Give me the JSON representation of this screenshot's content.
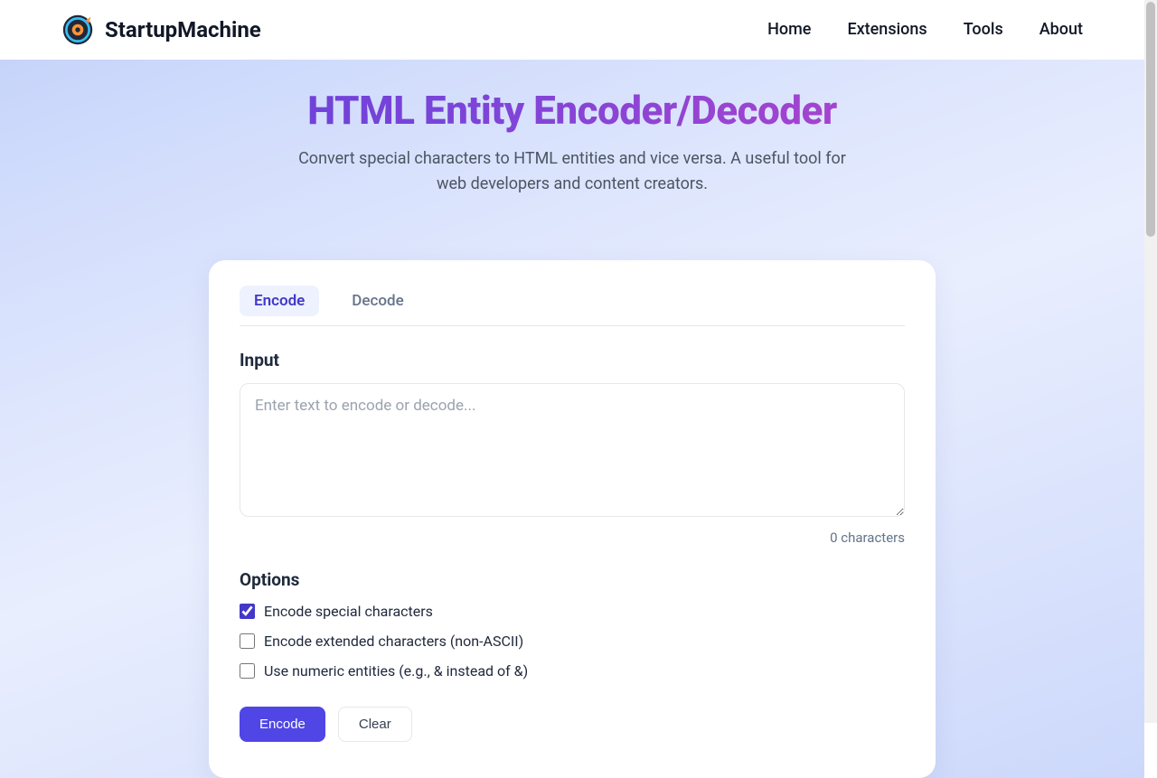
{
  "header": {
    "brand": "StartupMachine",
    "nav": {
      "home": "Home",
      "extensions": "Extensions",
      "tools": "Tools",
      "about": "About"
    }
  },
  "hero": {
    "title": "HTML Entity Encoder/Decoder",
    "subtitle": "Convert special characters to HTML entities and vice versa. A useful tool for web developers and content creators."
  },
  "card": {
    "tabs": {
      "encode": "Encode",
      "decode": "Decode"
    },
    "input_label": "Input",
    "input_placeholder": "Enter text to encode or decode...",
    "char_count": "0 characters",
    "options_label": "Options",
    "options": {
      "special": "Encode special characters",
      "extended": "Encode extended characters (non-ASCII)",
      "numeric": "Use numeric entities (e.g., & instead of &)"
    },
    "buttons": {
      "encode": "Encode",
      "clear": "Clear"
    }
  }
}
